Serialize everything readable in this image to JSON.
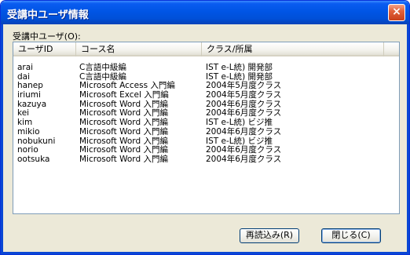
{
  "window": {
    "title": "受講中ユーザ情報",
    "close_glyph": "×"
  },
  "group_label": "受講中ユーザ(O):",
  "table": {
    "headers": [
      "ユーザID",
      "コース名",
      "クラス/所属",
      ""
    ],
    "rows": [
      [
        "arai",
        "C言語中級編",
        "IST e-L統) 開発部"
      ],
      [
        "dai",
        "C言語中級編",
        "IST e-L統) 開発部"
      ],
      [
        "hanep",
        "Microsoft Access 入門編",
        "2004年5月度クラス"
      ],
      [
        "iriumi",
        "Microsoft Excel 入門編",
        "2004年5月度クラス"
      ],
      [
        "kazuya",
        "Microsoft Word 入門編",
        "2004年6月度クラス"
      ],
      [
        "kei",
        "Microsoft Word 入門編",
        "2004年6月度クラス"
      ],
      [
        "kim",
        "Microsoft Word 入門編",
        "IST e-L統) ビジ推"
      ],
      [
        "mikio",
        "Microsoft Word 入門編",
        "2004年6月度クラス"
      ],
      [
        "nobukuni",
        "Microsoft Word 入門編",
        "IST e-L統) ビジ推"
      ],
      [
        "norio",
        "Microsoft Word 入門編",
        "2004年6月度クラス"
      ],
      [
        "ootsuka",
        "Microsoft Word 入門編",
        "2004年6月度クラス"
      ]
    ]
  },
  "buttons": {
    "reload": "再読込み(R)",
    "close": "閉じる(C)"
  }
}
